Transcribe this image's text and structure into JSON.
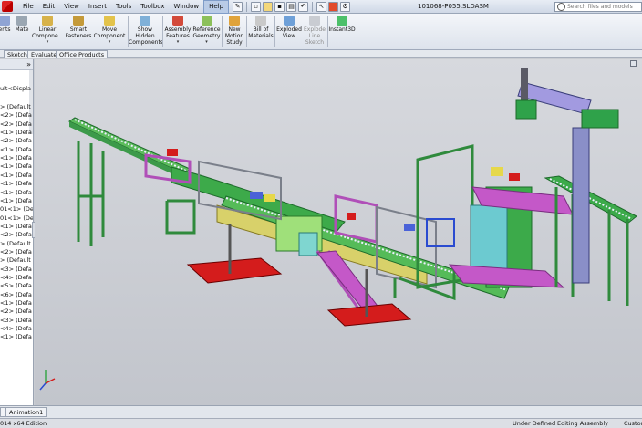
{
  "menu": {
    "items": [
      "File",
      "Edit",
      "View",
      "Insert",
      "Tools",
      "Toolbox",
      "Window",
      "Help"
    ],
    "active_index": 7
  },
  "document_title": "101068-P055.SLDASM",
  "search": {
    "placeholder": "Search files and models"
  },
  "ribbon": {
    "commands": [
      {
        "label1": "ents",
        "label2": "",
        "dropdown": false,
        "disabled": false
      },
      {
        "label1": "Mate",
        "label2": "",
        "dropdown": false,
        "disabled": false
      },
      {
        "label1": "Linear",
        "label2": "Compone...",
        "dropdown": true,
        "disabled": false
      },
      {
        "label1": "Smart",
        "label2": "Fasteners",
        "dropdown": false,
        "disabled": false
      },
      {
        "label1": "Move",
        "label2": "Component",
        "dropdown": true,
        "disabled": false
      },
      {
        "label1": "Show",
        "label2": "Hidden",
        "label3": "Components",
        "dropdown": false,
        "disabled": false
      },
      {
        "label1": "Assembly",
        "label2": "Features",
        "dropdown": true,
        "disabled": false
      },
      {
        "label1": "Reference",
        "label2": "Geometry",
        "dropdown": true,
        "disabled": false
      },
      {
        "label1": "New",
        "label2": "Motion",
        "label3": "Study",
        "dropdown": false,
        "disabled": false
      },
      {
        "label1": "Bill of",
        "label2": "Materials",
        "dropdown": false,
        "disabled": false
      },
      {
        "label1": "Exploded",
        "label2": "View",
        "dropdown": false,
        "disabled": false
      },
      {
        "label1": "Explode",
        "label2": "Line",
        "label3": "Sketch",
        "dropdown": false,
        "disabled": true
      },
      {
        "label1": "Instant3D",
        "label2": "",
        "dropdown": false,
        "disabled": false
      }
    ]
  },
  "tabs": [
    "Sketch",
    "Evaluate",
    "Office Products"
  ],
  "tree": {
    "top_item": "ult<Displa",
    "items": [
      "> (Default",
      "<2> (Defa",
      "<2> (Defa",
      "<1> (Defa",
      "<2> (Defa",
      "<1> (Defa",
      "<1> (Defa",
      "<1> (Defa",
      "<1> (Defa",
      "<1> (Defa",
      "<1> (Defa",
      "<1> (Defa",
      "01<1> (De",
      "01<1> (De",
      "<1> (Defa",
      "<2> (Defa",
      "> (Default",
      "<2> (Defa",
      "> (Default",
      "<3> (Defa",
      "<4> (Defa",
      "<5> (Defa",
      "<6> (Defa",
      "<1> (Defa",
      "<2> (Defa",
      "<3> (Defa",
      "<4> (Defa",
      "<1> (Defa"
    ]
  },
  "bottom_tabs": [
    "Animation1"
  ],
  "status": {
    "edition": "014 x64 Edition",
    "defined": "Under Defined",
    "mode": "Editing Assembly",
    "units": "Custom"
  },
  "colors": {
    "frame_green": "#3aa64a",
    "accent_magenta": "#c458c8",
    "accent_red": "#d41c1c",
    "accent_yellow": "#e6d84a",
    "accent_blue": "#6f7fd8"
  },
  "icons": {
    "logo": "solidworks-logo-icon",
    "search": "search-icon",
    "triad": "coordinate-triad-icon"
  }
}
